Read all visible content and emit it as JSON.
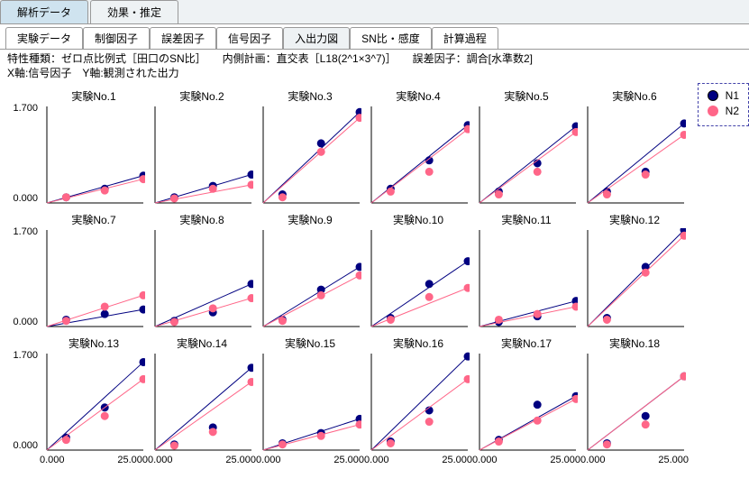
{
  "outerTabs": [
    {
      "label": "解析データ",
      "active": true
    },
    {
      "label": "効果・推定",
      "active": false
    }
  ],
  "innerTabs": [
    {
      "label": "実験データ"
    },
    {
      "label": "制御因子"
    },
    {
      "label": "誤差因子"
    },
    {
      "label": "信号因子"
    },
    {
      "label": "入出力図",
      "active": true
    },
    {
      "label": "SN比・感度"
    },
    {
      "label": "計算過程"
    }
  ],
  "meta": {
    "line1": "特性種類：ゼロ点比例式［田口のSN比］　　内側計画：直交表［L18(2^1×3^7)］　　誤差因子：調合[水準数2]",
    "line2": "X軸:信号因子　Y軸:観測された出力"
  },
  "legend": [
    {
      "name": "N1",
      "color": "#000080"
    },
    {
      "name": "N2",
      "color": "#ff6688"
    }
  ],
  "axis": {
    "ymin": "0.000",
    "ymax": "1.700",
    "xmin": "0.000",
    "xmax": "25.000",
    "xlo": 0,
    "xhi": 25,
    "ylo": 0,
    "yhi": 1.7
  },
  "chart_data": {
    "type": "scatter-grid",
    "title_prefix": "実験No.",
    "series_colors": {
      "N1": "#000080",
      "N2": "#ff6688"
    },
    "x": [
      5,
      15,
      25
    ],
    "experiments": [
      {
        "no": 1,
        "N1": [
          0.1,
          0.25,
          0.48
        ],
        "N2": [
          0.1,
          0.22,
          0.42
        ]
      },
      {
        "no": 2,
        "N1": [
          0.1,
          0.3,
          0.5
        ],
        "N2": [
          0.08,
          0.25,
          0.32
        ]
      },
      {
        "no": 3,
        "N1": [
          0.15,
          1.05,
          1.6
        ],
        "N2": [
          0.1,
          0.9,
          1.5
        ]
      },
      {
        "no": 4,
        "N1": [
          0.25,
          0.75,
          1.37
        ],
        "N2": [
          0.2,
          0.55,
          1.3
        ]
      },
      {
        "no": 5,
        "N1": [
          0.2,
          0.7,
          1.35
        ],
        "N2": [
          0.15,
          0.55,
          1.25
        ]
      },
      {
        "no": 6,
        "N1": [
          0.2,
          0.55,
          1.4
        ],
        "N2": [
          0.15,
          0.5,
          1.2
        ]
      },
      {
        "no": 7,
        "N1": [
          0.12,
          0.22,
          0.3
        ],
        "N2": [
          0.1,
          0.35,
          0.55
        ]
      },
      {
        "no": 8,
        "N1": [
          0.1,
          0.25,
          0.75
        ],
        "N2": [
          0.08,
          0.32,
          0.5
        ]
      },
      {
        "no": 9,
        "N1": [
          0.12,
          0.65,
          1.05
        ],
        "N2": [
          0.1,
          0.55,
          0.9
        ]
      },
      {
        "no": 10,
        "N1": [
          0.15,
          0.75,
          1.15
        ],
        "N2": [
          0.12,
          0.52,
          0.68
        ]
      },
      {
        "no": 11,
        "N1": [
          0.08,
          0.18,
          0.45
        ],
        "N2": [
          0.12,
          0.22,
          0.35
        ]
      },
      {
        "no": 12,
        "N1": [
          0.15,
          1.05,
          1.7
        ],
        "N2": [
          0.12,
          0.95,
          1.6
        ]
      },
      {
        "no": 13,
        "N1": [
          0.22,
          0.75,
          1.55
        ],
        "N2": [
          0.18,
          0.6,
          1.25
        ]
      },
      {
        "no": 14,
        "N1": [
          0.1,
          0.4,
          1.45
        ],
        "N2": [
          0.08,
          0.32,
          1.2
        ]
      },
      {
        "no": 15,
        "N1": [
          0.12,
          0.3,
          0.55
        ],
        "N2": [
          0.1,
          0.25,
          0.45
        ]
      },
      {
        "no": 16,
        "N1": [
          0.15,
          0.7,
          1.65
        ],
        "N2": [
          0.12,
          0.5,
          1.25
        ]
      },
      {
        "no": 17,
        "N1": [
          0.18,
          0.8,
          0.95
        ],
        "N2": [
          0.15,
          0.52,
          0.9
        ]
      },
      {
        "no": 18,
        "N1": [
          0.12,
          0.6,
          1.3
        ],
        "N2": [
          0.1,
          0.45,
          1.3
        ]
      }
    ]
  }
}
